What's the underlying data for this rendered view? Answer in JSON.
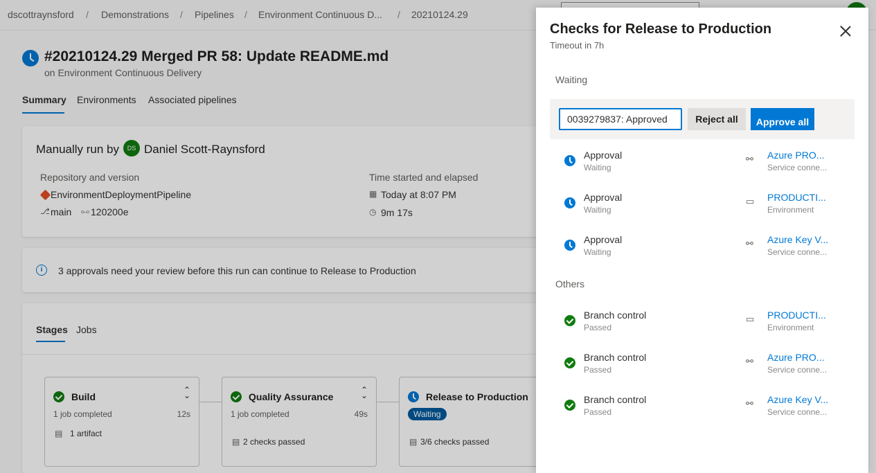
{
  "breadcrumbs": [
    "dscottraynsford",
    "Demonstrations",
    "Pipelines",
    "Environment Continuous D...",
    "20210124.29"
  ],
  "run": {
    "title": "#20210124.29 Merged PR 58: Update README.md",
    "subtitle": "on Environment Continuous Delivery"
  },
  "tabs": [
    "Summary",
    "Environments",
    "Associated pipelines"
  ],
  "summary": {
    "manual_label": "Manually run by",
    "avatar_initials": "DS",
    "author": "Daniel Scott-Raynsford",
    "repo_label": "Repository and version",
    "repo_name": "EnvironmentDeploymentPipeline",
    "branch": "main",
    "commit": "120200e",
    "time_label": "Time started and elapsed",
    "started": "Today at 8:07 PM",
    "elapsed": "9m 17s"
  },
  "notice": "3 approvals need your review before this run can continue to Release to Production",
  "stage_tabs": [
    "Stages",
    "Jobs"
  ],
  "stages": [
    {
      "name": "Build",
      "jobs": "1 job completed",
      "time": "12s",
      "extra": "1 artifact",
      "status": "passed"
    },
    {
      "name": "Quality Assurance",
      "jobs": "1 job completed",
      "time": "49s",
      "extra": "2 checks passed",
      "status": "passed"
    },
    {
      "name": "Release to Production",
      "status_label": "Waiting",
      "extra": "3/6 checks passed",
      "status": "waiting"
    }
  ],
  "panel": {
    "title": "Checks for Release to Production",
    "subtitle": "Timeout in 7h",
    "waiting_header": "Waiting",
    "others_header": "Others",
    "comment_value": "0039279837: Approved",
    "reject_label": "Reject all",
    "approve_label": "Approve all",
    "waiting_checks": [
      {
        "name": "Approval",
        "status": "Waiting",
        "resource": "Azure PRO...",
        "resource_type": "Service conne...",
        "resource_icon": "link-icon"
      },
      {
        "name": "Approval",
        "status": "Waiting",
        "resource": "PRODUCTI...",
        "resource_type": "Environment",
        "resource_icon": "server-icon"
      },
      {
        "name": "Approval",
        "status": "Waiting",
        "resource": "Azure Key V...",
        "resource_type": "Service conne...",
        "resource_icon": "link-icon"
      }
    ],
    "other_checks": [
      {
        "name": "Branch control",
        "status": "Passed",
        "resource": "PRODUCTI...",
        "resource_type": "Environment",
        "resource_icon": "server-icon"
      },
      {
        "name": "Branch control",
        "status": "Passed",
        "resource": "Azure PRO...",
        "resource_type": "Service conne...",
        "resource_icon": "link-icon"
      },
      {
        "name": "Branch control",
        "status": "Passed",
        "resource": "Azure Key V...",
        "resource_type": "Service conne...",
        "resource_icon": "link-icon"
      }
    ]
  },
  "colors": {
    "accent": "#0078d4",
    "success": "#107c10",
    "waiting_pill": "#005a9e"
  }
}
